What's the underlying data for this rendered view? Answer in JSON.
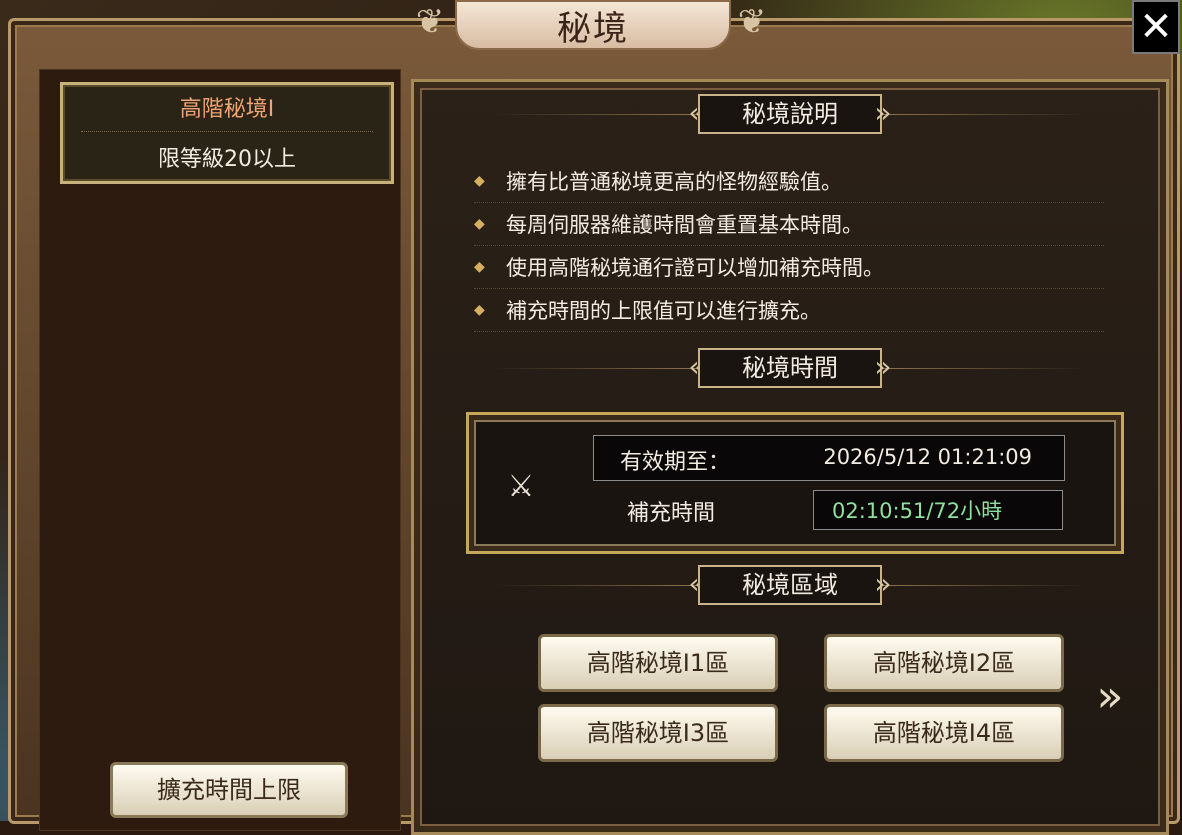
{
  "window": {
    "title": "秘境",
    "close_icon": "✕"
  },
  "left": {
    "level_card": {
      "title": "高階秘境I",
      "requirement": "限等級20以上"
    },
    "expand_button": "擴充時間上限"
  },
  "sections": {
    "description": {
      "title": "秘境說明",
      "items": [
        "擁有比普通秘境更高的怪物經驗值。",
        "每周伺服器維護時間會重置基本時間。",
        "使用高階秘境通行證可以增加補充時間。",
        "補充時間的上限值可以進行擴充。"
      ]
    },
    "time": {
      "title": "秘境時間",
      "expire_label": "有效期至：",
      "expire_value": "2026/5/12 01:21:09",
      "refill_label": "補充時間",
      "refill_value": "02:10:51/72小時"
    },
    "zones": {
      "title": "秘境區域",
      "buttons": [
        "高階秘境I1區",
        "高階秘境I2區",
        "高階秘境I3區",
        "高階秘境I4區"
      ]
    }
  },
  "colors": {
    "accent_orange": "#f0a373",
    "refill_green": "#8fe19d",
    "gold": "#c7a85a"
  }
}
